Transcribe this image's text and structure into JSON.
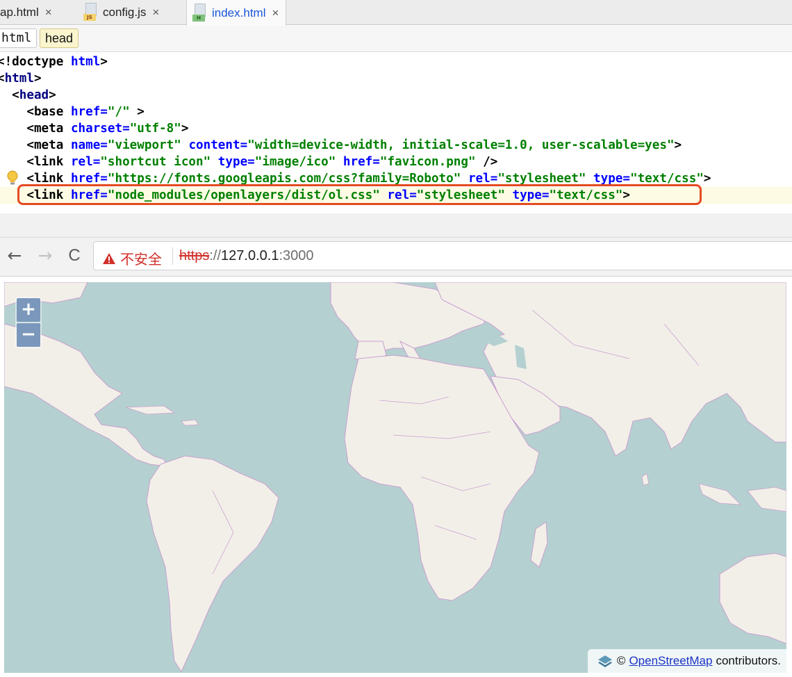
{
  "ide": {
    "tabs": [
      {
        "label": "ap.html",
        "close": "×"
      },
      {
        "label": "config.js",
        "close": "×",
        "icon_tag": "JS"
      },
      {
        "label": "index.html",
        "close": "×",
        "icon_tag": "H"
      }
    ],
    "breadcrumbs": [
      "html",
      "head"
    ],
    "code": {
      "l1": {
        "a": "<!doctype ",
        "b": "html",
        "c": ">"
      },
      "l2": {
        "a": "<",
        "b": "html",
        "c": ">"
      },
      "l3": {
        "a": "  <",
        "b": "head",
        "c": ">"
      },
      "l4": {
        "a": "    <base ",
        "b": "href=",
        "c": "\"/\"",
        "d": " >"
      },
      "l5": {
        "a": "    <meta ",
        "b": "charset=",
        "c": "\"utf-8\"",
        "d": ">"
      },
      "l6": {
        "a": "    <meta ",
        "b": "name=",
        "c": "\"viewport\"",
        "d": " ",
        "e": "content=",
        "f": "\"width=device-width, initial-scale=1.0, user-scalable=yes\"",
        "g": ">"
      },
      "l7": {
        "a": "    <link ",
        "b": "rel=",
        "c": "\"shortcut icon\"",
        "d": " ",
        "e": "type=",
        "f": "\"image/ico\"",
        "g": " ",
        "h": "href=",
        "i": "\"favicon.png\"",
        "j": " />"
      },
      "l8": {
        "a": "    <link ",
        "b": "href=",
        "c": "\"https://fonts.googleapis.com/css?family=Roboto\"",
        "d": " ",
        "e": "rel=",
        "f": "\"stylesheet\"",
        "g": " ",
        "h": "type=",
        "i": "\"text/css\"",
        "j": ">"
      },
      "l9": {
        "a": "    <link ",
        "b": "href=",
        "c": "\"node_modules/openlayers/dist/ol.css\"",
        "d": " ",
        "e": "rel=",
        "f": "\"stylesheet\"",
        "g": " ",
        "h": "type=",
        "i": "\"text/css\"",
        "j": ">"
      }
    }
  },
  "browser": {
    "back": "←",
    "forward": "→",
    "reload": "C",
    "security_label": "不安全",
    "url_scheme": "https",
    "url_sep": "://",
    "url_host": "127.0.0.1",
    "url_port": ":3000"
  },
  "map": {
    "zoom_in": "+",
    "zoom_out": "−",
    "attribution_prefix": "©",
    "attribution_link": "OpenStreetMap",
    "attribution_suffix": "contributors."
  },
  "colors": {
    "tag": "#000080",
    "attribute": "#0000ff",
    "value": "#008000",
    "highlight_box": "#e54b22",
    "ocean": "#b5d0d0",
    "land": "#f2efe9",
    "border": "#c9a0cf",
    "zoom_button": "#7b98bc"
  }
}
